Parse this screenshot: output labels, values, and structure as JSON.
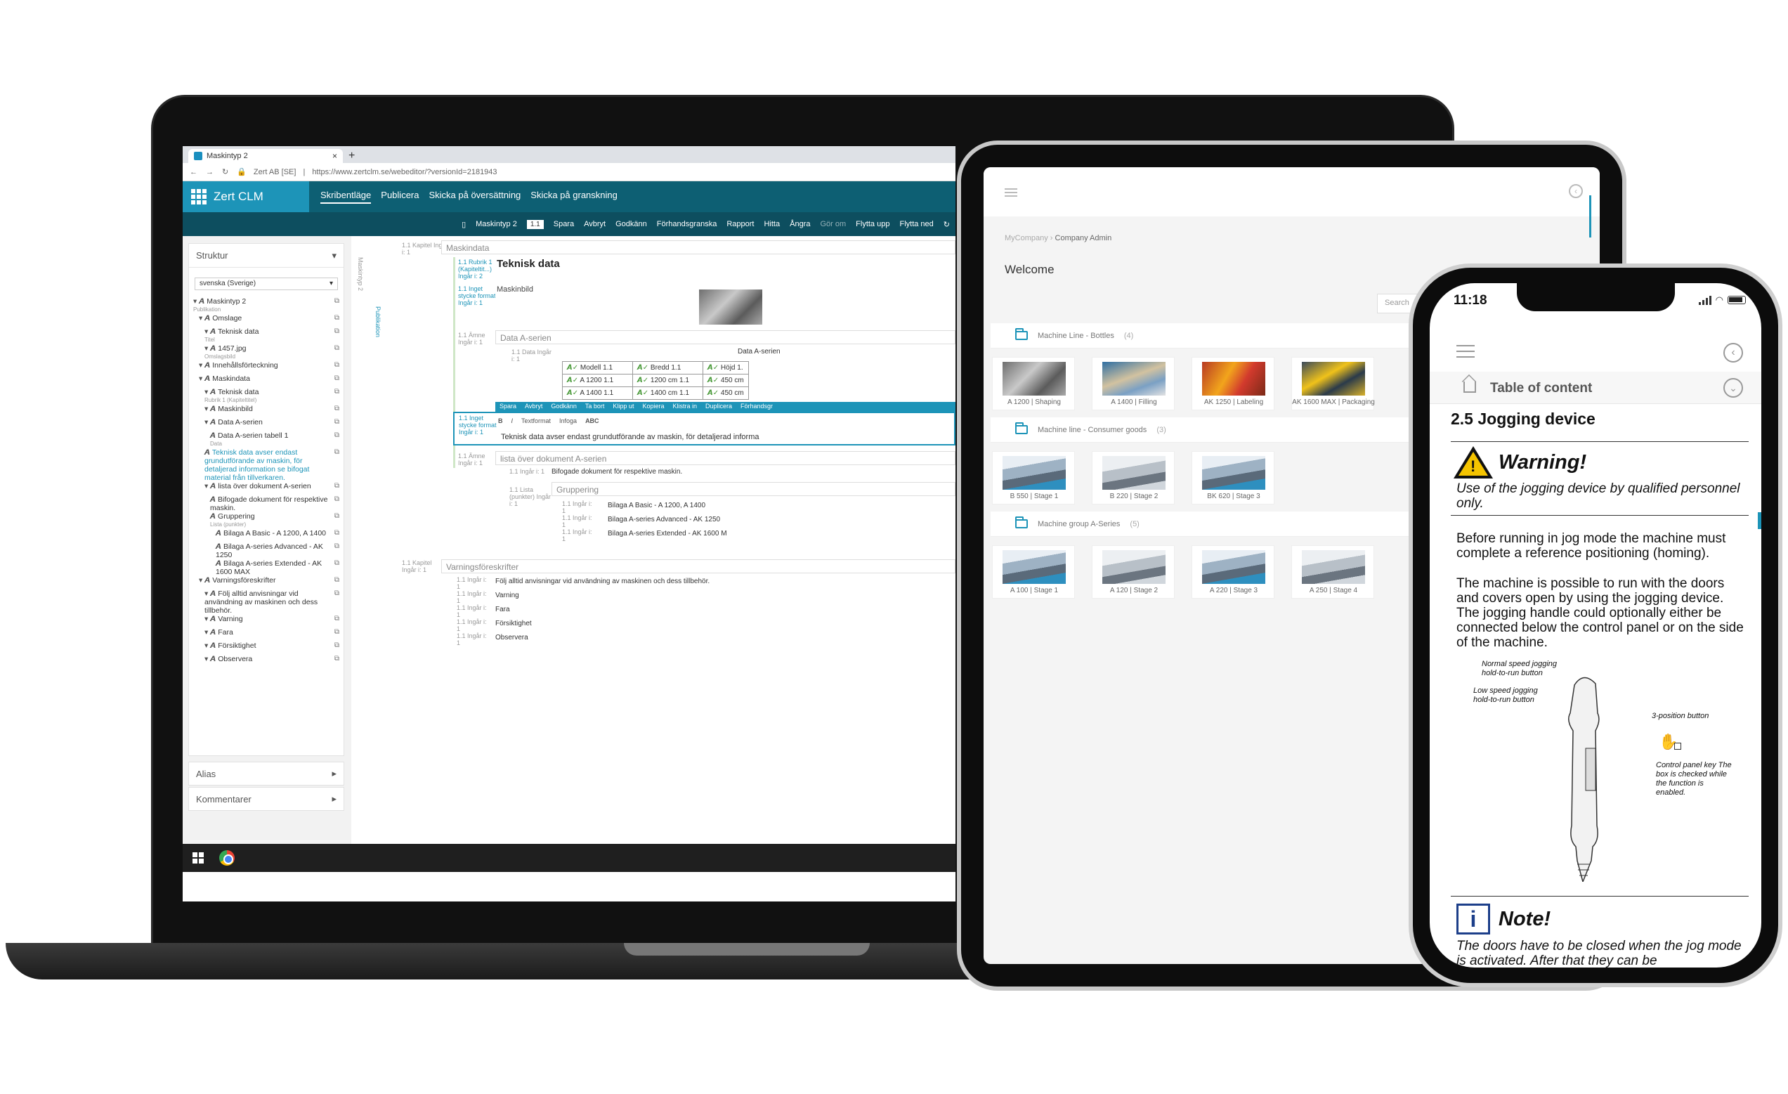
{
  "laptop": {
    "browser": {
      "tab_title": "Maskintyp 2",
      "tab_close": "×",
      "new_tab": "+",
      "site_label": "Zert AB [SE]",
      "url": "https://www.zertclm.se/webeditor/?versionId=2181943"
    },
    "app": {
      "logo": "Zert CLM",
      "menu": [
        "Skribentläge",
        "Publicera",
        "Skicka på översättning",
        "Skicka på granskning"
      ]
    },
    "toolbar": {
      "doc": "Maskintyp 2",
      "version": "1.1",
      "items": [
        "Spara",
        "Avbryt",
        "Godkänn",
        "Förhandsgranska",
        "Rapport",
        "Hitta",
        "Ångra",
        "Gör om",
        "Flytta upp",
        "Flytta ned"
      ]
    },
    "structure": {
      "title": "Struktur",
      "language": "svenska (Sverige)",
      "tree": [
        {
          "label": "Maskintyp 2",
          "sub": "Publikation",
          "indent": 0
        },
        {
          "label": "Omslage",
          "sub": "",
          "indent": 1
        },
        {
          "label": "Teknisk data",
          "sub": "Titel",
          "indent": 2
        },
        {
          "label": "1457.jpg",
          "sub": "Omslagsbild",
          "indent": 2
        },
        {
          "label": "Innehållsförteckning",
          "sub": "",
          "indent": 1
        },
        {
          "label": "Maskindata",
          "sub": "",
          "indent": 1
        },
        {
          "label": "Teknisk data",
          "sub": "Rubrik 1 (Kapiteltitel)",
          "indent": 2
        },
        {
          "label": "Maskinbild",
          "sub": "",
          "indent": 2
        },
        {
          "label": "Data A-serien",
          "sub": "",
          "indent": 2
        },
        {
          "label": "Data A-serien tabell 1",
          "sub": "Data",
          "indent": 3
        },
        {
          "label": "Teknisk data avser endast grundutförande av maskin, för detaljerad information se bifogat material från tillverkaren.",
          "sub": "",
          "indent": 2,
          "blue": true
        },
        {
          "label": "lista över dokument A-serien",
          "sub": "",
          "indent": 2
        },
        {
          "label": "Bifogade dokument för respektive maskin.",
          "sub": "",
          "indent": 3
        },
        {
          "label": "Gruppering",
          "sub": "Lista (punkter)",
          "indent": 3
        },
        {
          "label": "Bilaga A Basic - A 1200, A 1400",
          "sub": "",
          "indent": 4
        },
        {
          "label": "Bilaga A-series Advanced - AK 1250",
          "sub": "",
          "indent": 4
        },
        {
          "label": "Bilaga A-series Extended - AK 1600 MAX",
          "sub": "",
          "indent": 4
        },
        {
          "label": "Varningsföreskrifter",
          "sub": "",
          "indent": 1
        },
        {
          "label": "Följ alltid anvisningar vid användning av maskinen och dess tillbehör.",
          "sub": "",
          "indent": 2
        },
        {
          "label": "Varning",
          "sub": "",
          "indent": 2
        },
        {
          "label": "Fara",
          "sub": "",
          "indent": 2
        },
        {
          "label": "Försiktighet",
          "sub": "",
          "indent": 2
        },
        {
          "label": "Observera",
          "sub": "",
          "indent": 2
        }
      ],
      "alias": "Alias",
      "comments": "Kommentarer"
    },
    "editor": {
      "vertical_1": "Maskintyp 2",
      "vertical_2": "Publikation",
      "chapter": "Maskindata",
      "chapter_meta": "1.1 Kapitel Ingår i: 1",
      "heading_meta": "1.1 Rubrik 1 (Kapiteltit...) Ingår i: 2",
      "image_meta": "1.1 Inget stycke format Ingår i: 1",
      "topic_meta": "1.1 Ämne Ingår i: 1",
      "data_meta": "1.1 Data Ingår i: 1",
      "list_meta": "1.1 Lista (punkter) Ingår i: 1",
      "entry_meta": "1.1 Ingår i: 1",
      "heading": "Teknisk data",
      "machine_image": "Maskinbild",
      "data_series": "Data A-serien",
      "table": {
        "caption": "Data A-serien",
        "rows": [
          [
            "Modell 1.1",
            "Bredd 1.1",
            "Höjd 1."
          ],
          [
            "A 1200 1.1",
            "1200 cm 1.1",
            "450 cm"
          ],
          [
            "A 1400 1.1",
            "1400 cm 1.1",
            "450 cm"
          ]
        ]
      },
      "insert_bar": [
        "Spara",
        "Avbryt",
        "Godkänn",
        "Ta bort",
        "Klipp ut",
        "Kopiera",
        "Klistra in",
        "Duplicera",
        "Förhandsgr"
      ],
      "format_bar": [
        "B",
        "I",
        "Textformat",
        "Infoga",
        "ABC"
      ],
      "text_line": "Teknisk data avser endast grundutförande av maskin, för detaljerad informa",
      "list_title": "lista över dokument A-serien",
      "list_intro": "Bifogade dokument för respektive maskin.",
      "group": "Gruppering",
      "group_items": [
        "Bilaga A Basic - A 1200, A 1400",
        "Bilaga A-series Advanced - AK 1250",
        "Bilaga A-series Extended - AK 1600 M"
      ],
      "warnings_title": "Varningsföreskrifter",
      "warnings": [
        "Följ alltid anvisningar vid användning av maskinen och dess tillbehör.",
        "Varning",
        "Fara",
        "Försiktighet",
        "Observera"
      ]
    }
  },
  "tablet": {
    "breadcrumb": [
      "MyCompany",
      "Company Admin"
    ],
    "welcome": "Welcome",
    "search_placeholder": "Search",
    "sections": [
      {
        "title": "Machine Line - Bottles",
        "count": "(4)",
        "cards": [
          "A 1200 | Shaping",
          "A 1400 | Filling",
          "AK 1250 | Labeling",
          "AK 1600 MAX | Packaging"
        ]
      },
      {
        "title": "Machine line - Consumer goods",
        "count": "(3)",
        "cards": [
          "B 550 | Stage 1",
          "B 220 | Stage 2",
          "BK 620 | Stage 3"
        ]
      },
      {
        "title": "Machine group A-Series",
        "count": "(5)",
        "cards": [
          "A 100 | Stage 1",
          "A 120 | Stage 2",
          "A 220 | Stage 3",
          "A 250 | Stage 4"
        ]
      }
    ]
  },
  "phone": {
    "time": "11:18",
    "toc": "Table of content",
    "heading": "2.5  Jogging device",
    "warning_title": "Warning!",
    "warning_text": "Use of the jogging device by qualified personnel only.",
    "para1": "Before running in jog mode the machine must complete a reference positioning (homing).",
    "para2": "The machine is possible to run with the doors and covers open by using the jogging device. The jogging handle could optionally either be connected below the control panel or on the side of the machine.",
    "figure_labels": {
      "normal": "Normal speed jogging hold-to-run button",
      "low": "Low speed jogging hold-to-run button",
      "three": "3-position button",
      "key": "Control panel key The box is checked while the function is enabled."
    },
    "note_title": "Note!",
    "note_text": "The doors have to be closed when the jog mode is activated. After that they can be"
  },
  "colors": {
    "brand_teal": "#0d5f73",
    "brand_blue": "#1d94b8",
    "warning_yellow": "#f5c400",
    "note_blue": "#1d3f8a"
  }
}
